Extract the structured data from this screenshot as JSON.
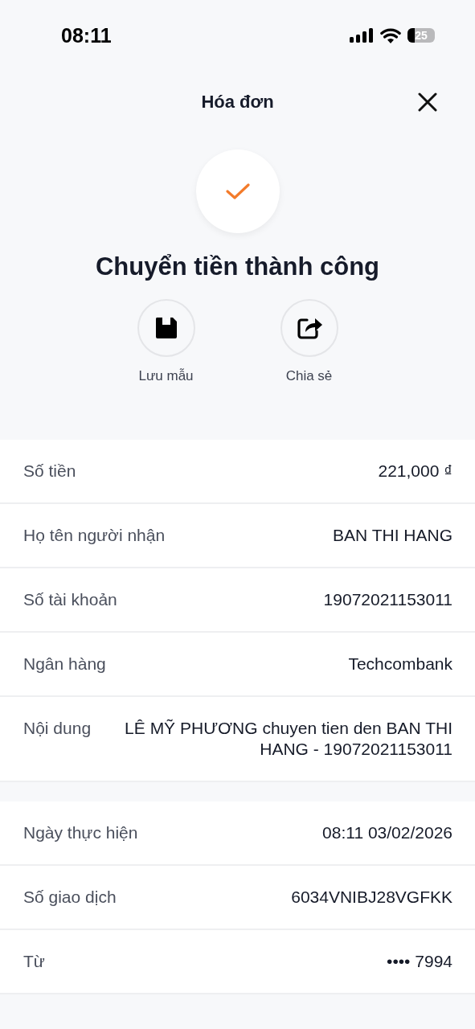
{
  "status_bar": {
    "time": "08:11",
    "battery": "25"
  },
  "header": {
    "title": "Hóa đơn"
  },
  "result": {
    "title": "Chuyển tiền thành công"
  },
  "actions": [
    {
      "kind": "save",
      "label": "Lưu mẫu"
    },
    {
      "kind": "share",
      "label": "Chia sẻ"
    }
  ],
  "details": [
    {
      "label": "Số tiền",
      "value": "221,000 ₫"
    },
    {
      "label": "Họ tên người nhận",
      "value": "BAN THI HANG"
    },
    {
      "label": "Số tài khoản",
      "value": "19072021153011"
    },
    {
      "label": "Ngân hàng",
      "value": "Techcombank"
    },
    {
      "label": "Nội dung",
      "value": "LÊ MỸ PHƯƠNG chuyen tien den BAN THI HANG - 19072021153011"
    }
  ],
  "transaction": [
    {
      "label": "Ngày thực hiện",
      "value": "08:11 03/02/2026"
    },
    {
      "label": "Số giao dịch",
      "value": "6034VNIBJ28VGFKK"
    },
    {
      "label": "Từ",
      "value": "•••• 7994"
    }
  ]
}
